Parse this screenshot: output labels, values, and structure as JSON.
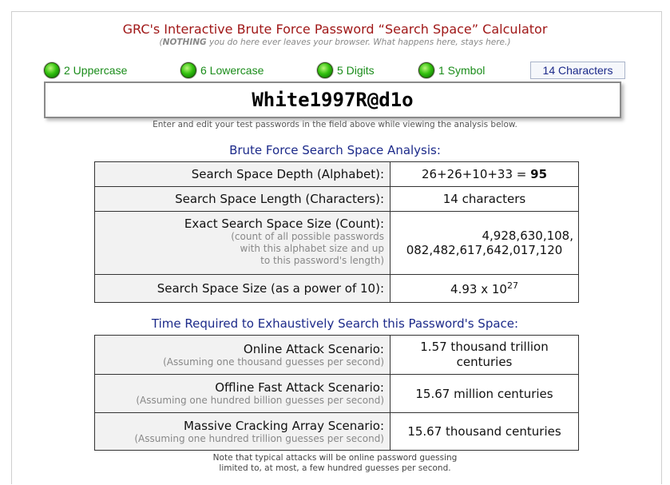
{
  "header": {
    "title": "GRC's Interactive Brute Force Password “Search Space” Calculator",
    "subtitle_bold": "NOTHING",
    "subtitle_rest": " you do here ever leaves your browser. What happens here, stays here.)",
    "subtitle_open": "("
  },
  "indicators": [
    {
      "label": "2 Uppercase",
      "status": "on"
    },
    {
      "label": "6 Lowercase",
      "status": "on"
    },
    {
      "label": "5 Digits",
      "status": "on"
    },
    {
      "label": "1 Symbol",
      "status": "on"
    }
  ],
  "char_count": "14 Characters",
  "password": "White1997R@d1o",
  "hint": "Enter and edit your test passwords in the field above while viewing the analysis below.",
  "analysis": {
    "heading": "Brute Force Search Space Analysis:",
    "depth_label": "Search Space Depth (Alphabet):",
    "depth_formula": "26+26+10+33 = ",
    "depth_total": "95",
    "length_label": "Search Space Length (Characters):",
    "length_value": "14 characters",
    "exact_label": "Exact Search Space Size (Count):",
    "exact_note_1": "(count of all possible passwords",
    "exact_note_2": "with this alphabet size and up",
    "exact_note_3": "to this password's length)",
    "exact_value_1": "4,928,630,108,",
    "exact_value_2": "082,482,617,642,017,120",
    "power_label": "Search Space Size (as a power of 10):",
    "power_mantissa": "4.93 x 10",
    "power_exponent": "27"
  },
  "time": {
    "heading": "Time Required to Exhaustively Search this Password's Space:",
    "online_label": "Online Attack Scenario:",
    "online_note": "(Assuming one thousand guesses per second)",
    "online_value_1": "1.57 thousand trillion",
    "online_value_2": "centuries",
    "offline_label": "Offline Fast Attack Scenario:",
    "offline_note": "(Assuming one hundred billion guesses per second)",
    "offline_value": "15.67 million centuries",
    "massive_label": "Massive Cracking Array Scenario:",
    "massive_note": "(Assuming one hundred trillion guesses per second)",
    "massive_value": "15.67 thousand centuries"
  },
  "footer": {
    "note_1": "Note that typical attacks will be online password guessing",
    "note_2": "limited to, at most, a few hundred guesses per second."
  },
  "colors": {
    "title": "#a01818",
    "section": "#1c2a8a",
    "indicator_label": "#1a8c1a",
    "led": "#34c20f"
  }
}
